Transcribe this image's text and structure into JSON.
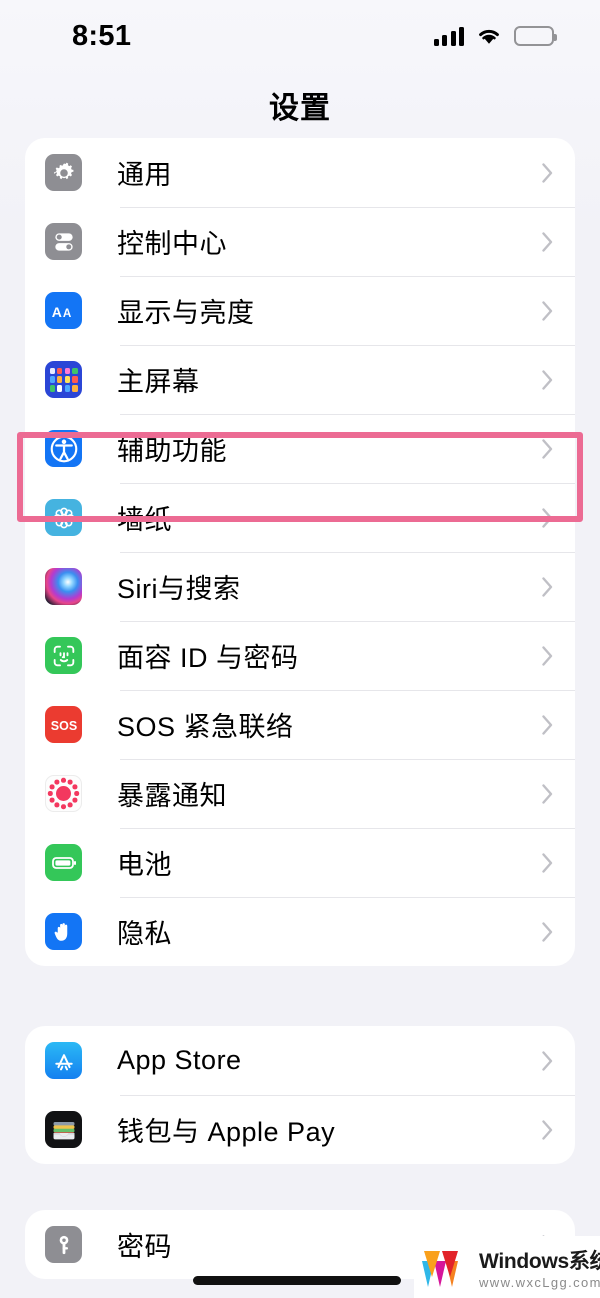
{
  "status_bar": {
    "time": "8:51",
    "signal_icon": "cellular-signal-icon",
    "wifi_icon": "wifi-icon",
    "battery_icon": "battery-full-icon"
  },
  "navbar": {
    "title": "设置"
  },
  "highlight": {
    "target": "辅助功能",
    "color": "#ec6b93"
  },
  "groups": [
    {
      "rows": [
        {
          "label": "通用",
          "icon": "gear-icon",
          "chevron": "chevron-right-icon"
        },
        {
          "label": "控制中心",
          "icon": "control-center-icon",
          "chevron": "chevron-right-icon"
        },
        {
          "label": "显示与亮度",
          "icon": "display-brightness-icon",
          "chevron": "chevron-right-icon"
        },
        {
          "label": "主屏幕",
          "icon": "home-screen-icon",
          "chevron": "chevron-right-icon"
        },
        {
          "label": "辅助功能",
          "icon": "accessibility-icon",
          "chevron": "chevron-right-icon"
        },
        {
          "label": "墙纸",
          "icon": "wallpaper-icon",
          "chevron": "chevron-right-icon"
        },
        {
          "label": "Siri与搜索",
          "icon": "siri-icon",
          "chevron": "chevron-right-icon"
        },
        {
          "label": "面容 ID 与密码",
          "icon": "face-id-icon",
          "chevron": "chevron-right-icon"
        },
        {
          "label": "SOS 紧急联络",
          "icon": "emergency-sos-icon",
          "chevron": "chevron-right-icon"
        },
        {
          "label": "暴露通知",
          "icon": "exposure-notification-icon",
          "chevron": "chevron-right-icon"
        },
        {
          "label": "电池",
          "icon": "battery-icon",
          "chevron": "chevron-right-icon"
        },
        {
          "label": "隐私",
          "icon": "privacy-hand-icon",
          "chevron": "chevron-right-icon"
        }
      ]
    },
    {
      "rows": [
        {
          "label": "App Store",
          "icon": "app-store-icon",
          "chevron": "chevron-right-icon"
        },
        {
          "label": "钱包与 Apple Pay",
          "icon": "wallet-icon",
          "chevron": "chevron-right-icon"
        }
      ]
    },
    {
      "rows": [
        {
          "label": "密码",
          "icon": "passwords-key-icon",
          "chevron": "chevron-right-icon"
        }
      ]
    }
  ],
  "watermark": {
    "title": "Windows系统城",
    "url": "www.wxcLgg.com"
  }
}
